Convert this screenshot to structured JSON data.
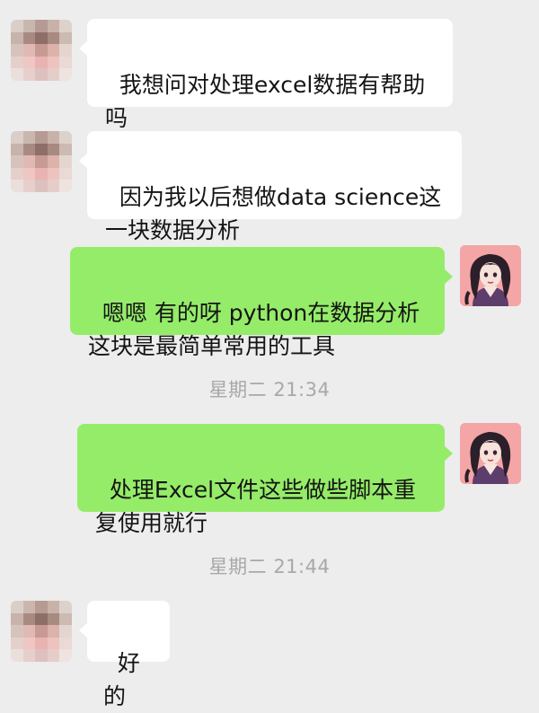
{
  "chat": {
    "messages": [
      {
        "sender": "contact",
        "avatar_icon": "blurred-contact-avatar-icon",
        "text": "我想问对处理excel数据有帮助吗"
      },
      {
        "sender": "contact",
        "avatar_icon": "blurred-contact-avatar-icon",
        "text": "因为我以后想做data science这一块数据分析"
      },
      {
        "sender": "me",
        "avatar_icon": "anime-girl-avatar-icon",
        "text": "嗯嗯 有的呀 python在数据分析这块是最简单常用的工具"
      },
      {
        "sender": "me",
        "avatar_icon": "anime-girl-avatar-icon",
        "text": "处理Excel文件这些做些脚本重复使用就行"
      },
      {
        "sender": "contact",
        "avatar_icon": "blurred-contact-avatar-icon",
        "text": "好的"
      }
    ],
    "timestamps": [
      {
        "text": "星期二 21:34"
      },
      {
        "text": "星期二 21:44"
      }
    ]
  },
  "colors": {
    "background": "#ededed",
    "incoming_bubble": "#ffffff",
    "outgoing_bubble": "#95ec69",
    "timestamp_text": "#a8a8a8"
  }
}
